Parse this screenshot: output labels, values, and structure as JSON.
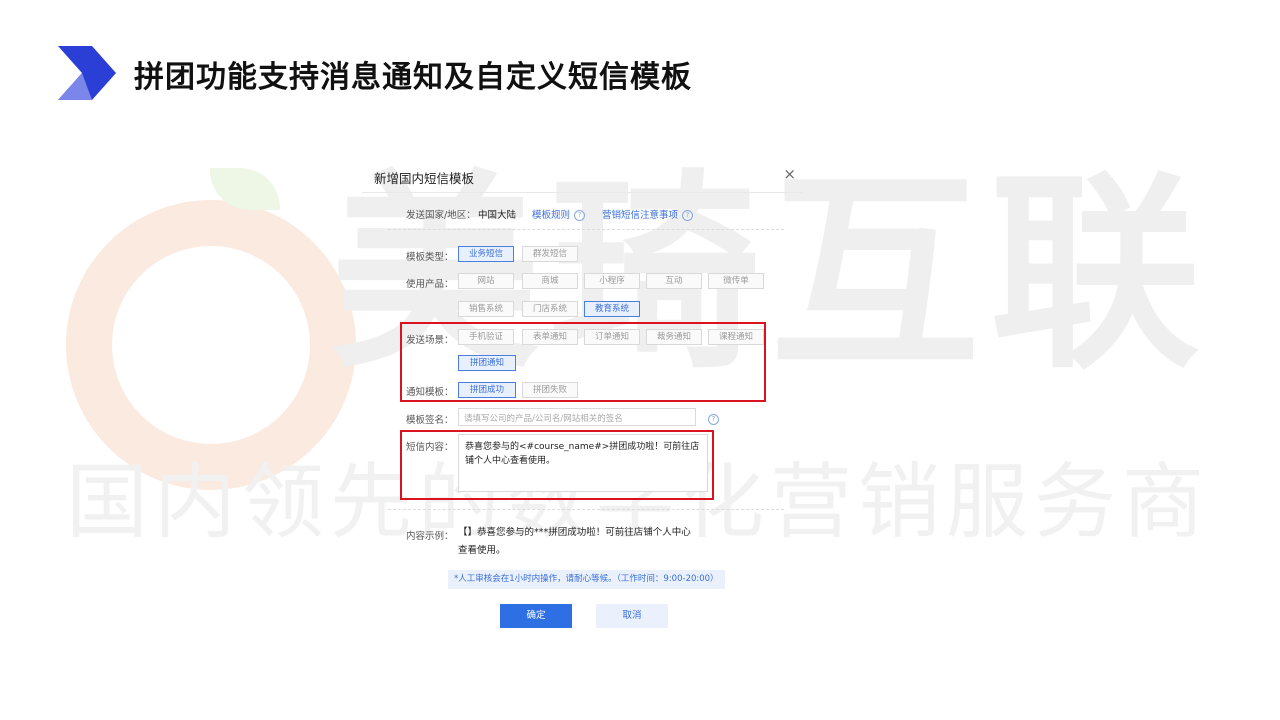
{
  "slide": {
    "title": "拼团功能支持消息通知及自定义短信模板"
  },
  "watermark": {
    "brand": "美琦互联",
    "tagline": "国内领先的数字化营销服务商"
  },
  "dialog": {
    "title": "新增国内短信模板",
    "close": "×",
    "region": {
      "label": "发送国家/地区：",
      "value": "中国大陆",
      "rules_link": "模板规则",
      "notice_link": "营销短信注意事项"
    },
    "template_type": {
      "label": "模板类型：",
      "options": [
        "业务短信",
        "群发短信"
      ],
      "selected": "业务短信"
    },
    "product": {
      "label": "使用产品：",
      "options": [
        "网站",
        "商城",
        "小程序",
        "互动",
        "微传单",
        "销售系统",
        "门店系统",
        "教育系统"
      ],
      "selected": "教育系统"
    },
    "scene": {
      "label": "发送场景：",
      "options": [
        "手机验证",
        "表单通知",
        "订单通知",
        "裁务通知",
        "课程通知",
        "拼团通知"
      ],
      "selected": "拼团通知"
    },
    "notify_template": {
      "label": "通知模板：",
      "options": [
        "拼团成功",
        "拼团失败"
      ],
      "selected": "拼团成功"
    },
    "signature": {
      "label": "模板签名：",
      "placeholder": "请填写公司的产品/公司名/网站相关的签名"
    },
    "content": {
      "label": "短信内容：",
      "value": "恭喜您参与的<#course_name#>拼团成功啦！可前往店铺个人中心查看使用。"
    },
    "example": {
      "label": "内容示例：",
      "value": "【】恭喜您参与的***拼团成功啦！可前往店铺个人中心查看使用。"
    },
    "review_notice": "*人工审核会在1小时内操作，请耐心等候。（工作时间：9:00-20:00）",
    "buttons": {
      "confirm": "确定",
      "cancel": "取消"
    }
  },
  "colors": {
    "accent": "#2f6fe4",
    "highlight": "#d9141e",
    "logo_dark": "#2b3fd6",
    "logo_light": "#7b86ea"
  },
  "icons": [
    "chevron-logo-icon",
    "close-icon",
    "help-icon"
  ]
}
